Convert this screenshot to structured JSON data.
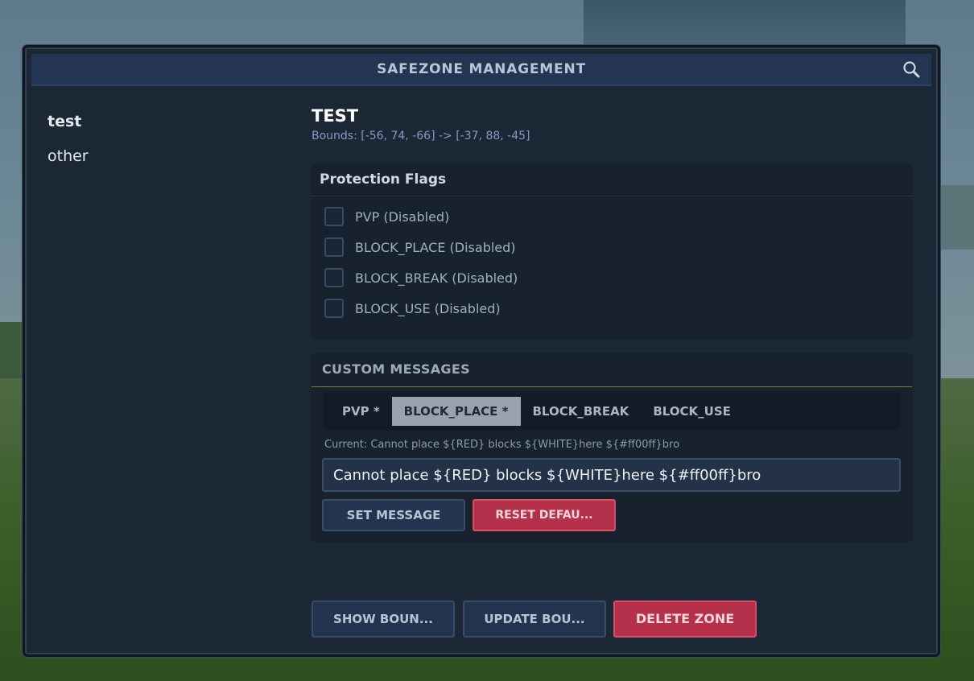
{
  "window": {
    "title": "SAFEZONE MANAGEMENT",
    "search_icon": "search-icon"
  },
  "zones": [
    {
      "label": "test",
      "selected": true
    },
    {
      "label": "other",
      "selected": false
    }
  ],
  "selected_zone": {
    "title": "TEST",
    "bounds": "Bounds: [-56, 74, -66] -> [-37, 88, -45]"
  },
  "protection_flags": {
    "header": "Protection Flags",
    "items": [
      {
        "label": "PVP (Disabled)",
        "checked": false
      },
      {
        "label": "BLOCK_PLACE (Disabled)",
        "checked": false
      },
      {
        "label": "BLOCK_BREAK (Disabled)",
        "checked": false
      },
      {
        "label": "BLOCK_USE (Disabled)",
        "checked": false
      }
    ]
  },
  "custom_messages": {
    "header": "CUSTOM MESSAGES",
    "tabs": [
      {
        "label": "PVP *",
        "active": false
      },
      {
        "label": "BLOCK_PLACE *",
        "active": true
      },
      {
        "label": "BLOCK_BREAK",
        "active": false
      },
      {
        "label": "BLOCK_USE",
        "active": false
      }
    ],
    "current": "Current: Cannot place ${RED} blocks ${WHITE}here ${#ff00ff}bro",
    "input_value": "Cannot place ${RED} blocks ${WHITE}here ${#ff00ff}bro",
    "set_label": "SET MESSAGE",
    "reset_label": "RESET DEFAU..."
  },
  "actions": {
    "show_bounds": "SHOW BOUN...",
    "update_bounds": "UPDATE BOU...",
    "delete_zone": "DELETE ZONE"
  },
  "colors": {
    "panel_bg": "#1c2736",
    "titlebar_bg": "#233552",
    "accent_red": "#b5304a",
    "button_blue": "#23344e",
    "tab_active": "#9aa2ad"
  }
}
